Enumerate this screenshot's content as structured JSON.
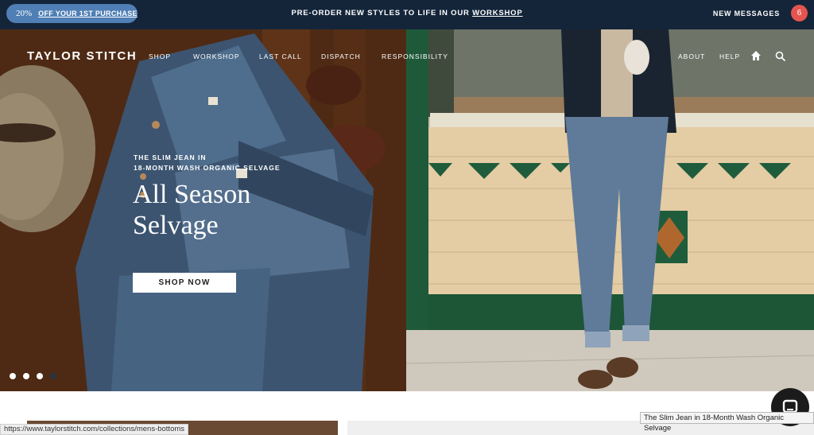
{
  "topbar": {
    "promo_percent": "20%",
    "promo_link": "OFF YOUR 1ST PURCHASE",
    "announcement_text": "PRE-ORDER NEW STYLES TO LIFE IN OUR ",
    "announcement_link": "WORKSHOP",
    "new_messages_label": "NEW  MESSAGES",
    "message_count": "6",
    "bg_color": "#14253a",
    "promo_color": "#4f7fb5",
    "badge_color": "#e4554f"
  },
  "header": {
    "logo": "TAYLOR STITCH",
    "nav_left": [
      "SHOP",
      "WORKSHOP",
      "LAST CALL",
      "DISPATCH",
      "RESPONSIBILITY"
    ],
    "nav_right": [
      "ABOUT",
      "HELP"
    ],
    "icons": [
      "home-icon",
      "search-icon"
    ]
  },
  "hero": {
    "eyebrow_line1": "THE SLIM JEAN IN",
    "eyebrow_line2": "18-MONTH WASH ORGANIC SELVAGE",
    "headline_line1": "All Season",
    "headline_line2": "Selvage",
    "cta_label": "SHOP NOW",
    "slide_count": 4,
    "active_slide": 4
  },
  "browser": {
    "status_url": "https://www.taylorstitch.com/collections/mens-bottoms",
    "tooltip": "The Slim Jean in 18-Month Wash Organic Selvage"
  }
}
